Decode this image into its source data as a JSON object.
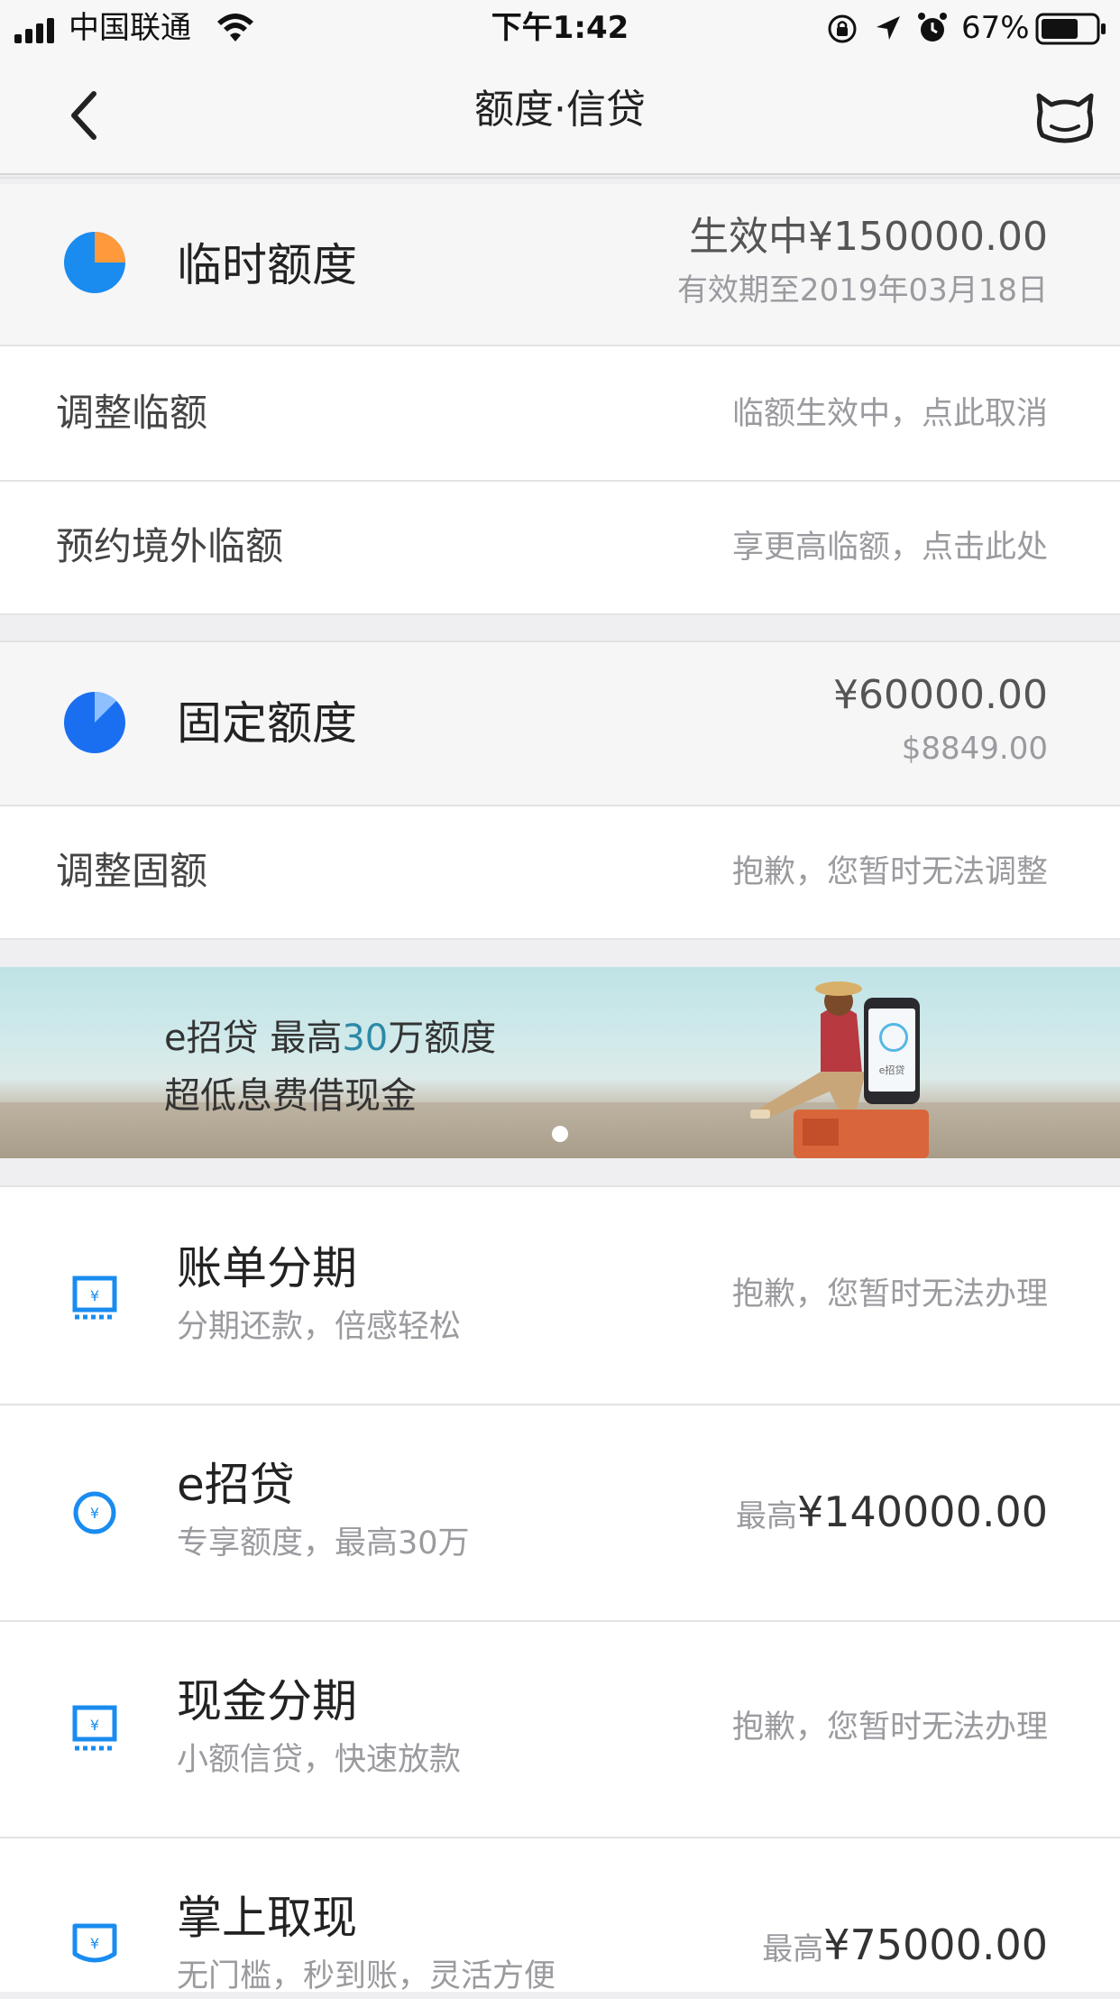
{
  "status_bar": {
    "carrier": "中国联通",
    "time": "下午1:42",
    "battery": "67%"
  },
  "nav": {
    "title": "额度·信贷"
  },
  "temp_limit": {
    "title": "临时额度",
    "amount": "生效中¥150000.00",
    "validity": "有效期至2019年03月18日",
    "rows": [
      {
        "label": "调整临额",
        "value": "临额生效中，点此取消"
      },
      {
        "label": "预约境外临额",
        "value": "享更高临额，点击此处"
      }
    ]
  },
  "fixed_limit": {
    "title": "固定额度",
    "amount": "¥60000.00",
    "amount_usd": "$8849.00",
    "rows": [
      {
        "label": "调整固额",
        "value": "抱歉，您暂时无法调整"
      }
    ]
  },
  "banner": {
    "line1_prefix": "e招贷  最高",
    "line1_highlight": "30",
    "line1_suffix": "万额度",
    "line2": "超低息费借现金",
    "phone_label": "e招贷"
  },
  "products": [
    {
      "title": "账单分期",
      "subtitle": "分期还款，倍感轻松",
      "right": "抱歉，您暂时无法办理"
    },
    {
      "title": "e招贷",
      "subtitle": "专享额度，最高30万",
      "right_prefix": "最高",
      "right_value": "¥140000.00"
    },
    {
      "title": "现金分期",
      "subtitle": "小额信贷，快速放款",
      "right": "抱歉，您暂时无法办理"
    },
    {
      "title": "掌上取现",
      "subtitle": "无门槛，秒到账，灵活方便",
      "right_prefix": "最高",
      "right_value": "¥75000.00"
    }
  ],
  "colors": {
    "accent_blue": "#1a8cf0",
    "accent_orange": "#ff9a3c",
    "banner_highlight": "#2c8aa6"
  }
}
